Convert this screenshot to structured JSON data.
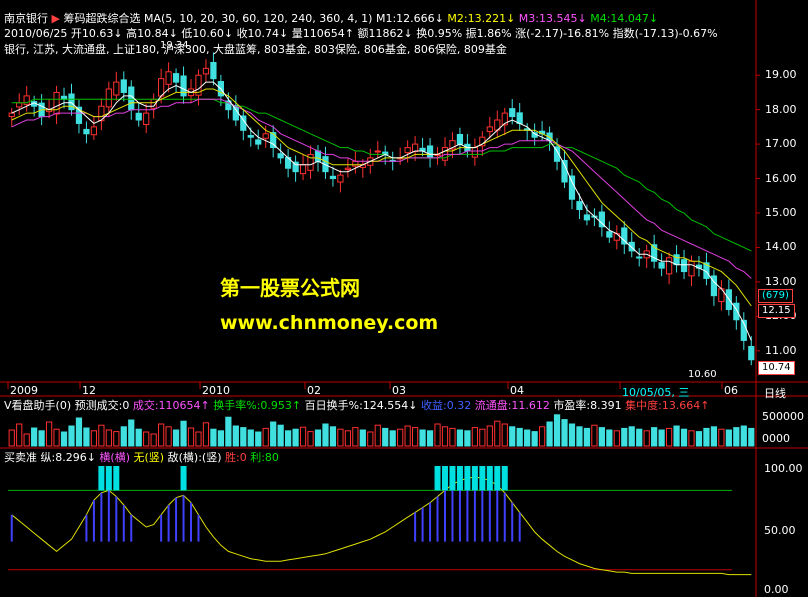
{
  "header": {
    "stock_name": "南京银行",
    "formula_name": "筹码超跌综合选",
    "ma_label": "MA(5, 10, 20, 30, 60, 120, 240, 360, 4, 1)",
    "m1": "M1:12.666↓",
    "m2": "M2:13.221↓",
    "m3": "M3:13.545↓",
    "m4": "M4:14.047↓"
  },
  "quote": {
    "date": "2010/06/25",
    "open": "开10.63↓",
    "high": "高10.84↓",
    "low": "低10.60↓",
    "close": "收10.74↓",
    "volume": "量110654↑",
    "amount": "额11862↓",
    "turnover": "换0.95%",
    "amplitude": "振1.86%",
    "change": "涨(-2.17)-16.81%",
    "index": "指数(-17.13)-0.67%"
  },
  "sectors": "银行, 江苏, 大流通盘, 上证180, 沪深300, 大盘蓝筹, 803基金, 803保险, 806基金, 806保险, 809基金",
  "price_axis": [
    "19.00",
    "18.00",
    "17.00",
    "16.00",
    "15.00",
    "14.00",
    "13.00",
    "12.00",
    "11.00"
  ],
  "price_box": {
    "label1": "(679)",
    "label2": "12.15",
    "current": "10.74",
    "low_mark": "10.60",
    "high_mark": "19.34"
  },
  "time_axis": [
    "2009",
    "12",
    "2010",
    "02",
    "03",
    "04",
    "10/05/05, 三",
    "06"
  ],
  "time_unit": "日线",
  "watermark": {
    "line1": "第一股票公式网",
    "line2": "www.chnmoney.com"
  },
  "volume_panel": {
    "title": "V看盘助手(0)",
    "forecast": "预测成交:0",
    "volume": "成交:110654↑",
    "turn": "换手率%:0.953↑",
    "turn100": "百日换手%:124.554↓",
    "profit": "收益:0.32",
    "float": "流通盘:11.612",
    "pe": "市盈率:8.391",
    "conc": "集中度:13.664↑",
    "axis": [
      "500000",
      "0000"
    ]
  },
  "indicator_panel": {
    "title": "买卖准",
    "v": "纵:8.296↓",
    "h1": "横(横)",
    "h2": "无(竖)",
    "enemy": "敌(横):(竖)",
    "win": "胜:0",
    "profit": "利:80",
    "axis": [
      "100.00",
      "50.00",
      "0.00"
    ]
  },
  "chart_data": {
    "type": "candlestick",
    "ylim": [
      10.5,
      19.5
    ],
    "closes": [
      17.9,
      18.2,
      18.4,
      18.1,
      17.8,
      18.0,
      18.5,
      18.3,
      18.0,
      17.6,
      17.3,
      17.5,
      18.1,
      18.6,
      18.8,
      18.5,
      18.0,
      17.7,
      17.9,
      18.3,
      18.9,
      19.1,
      18.8,
      18.4,
      18.6,
      19.0,
      19.2,
      18.9,
      18.4,
      18.0,
      17.7,
      17.4,
      17.2,
      17.0,
      17.3,
      16.9,
      16.6,
      16.3,
      16.2,
      16.4,
      16.7,
      16.5,
      16.2,
      16.0,
      16.1,
      16.3,
      16.5,
      16.4,
      16.6,
      16.8,
      16.7,
      16.5,
      16.6,
      16.9,
      17.0,
      16.8,
      16.6,
      16.7,
      16.9,
      17.1,
      17.0,
      16.8,
      16.9,
      17.2,
      17.5,
      17.7,
      17.9,
      17.8,
      17.6,
      17.4,
      17.2,
      17.3,
      17.1,
      16.5,
      15.9,
      15.4,
      15.1,
      14.8,
      14.9,
      14.6,
      14.3,
      14.4,
      14.1,
      13.9,
      13.7,
      13.9,
      13.6,
      13.4,
      13.7,
      13.5,
      13.3,
      13.6,
      13.4,
      13.1,
      12.6,
      12.8,
      12.2,
      11.9,
      11.3,
      10.74
    ],
    "ma_white": [
      17.9,
      18.0,
      18.1,
      18.2,
      18.1,
      18.0,
      18.1,
      18.2,
      18.2,
      18.0,
      17.8,
      17.6,
      17.7,
      17.9,
      18.2,
      18.4,
      18.4,
      18.2,
      18.1,
      18.1,
      18.4,
      18.6,
      18.7,
      18.6,
      18.5,
      18.6,
      18.8,
      18.8,
      18.6,
      18.3,
      18.0,
      17.7,
      17.4,
      17.2,
      17.1,
      17.0,
      16.8,
      16.6,
      16.4,
      16.4,
      16.4,
      16.5,
      16.4,
      16.3,
      16.2,
      16.2,
      16.3,
      16.4,
      16.5,
      16.6,
      16.7,
      16.6,
      16.6,
      16.7,
      16.8,
      16.8,
      16.7,
      16.7,
      16.8,
      16.9,
      17.0,
      16.9,
      16.9,
      17.0,
      17.2,
      17.4,
      17.6,
      17.7,
      17.6,
      17.5,
      17.3,
      17.2,
      17.1,
      16.8,
      16.4,
      15.9,
      15.5,
      15.1,
      14.9,
      14.7,
      14.5,
      14.4,
      14.2,
      14.0,
      13.8,
      13.8,
      13.7,
      13.6,
      13.6,
      13.5,
      13.5,
      13.5,
      13.4,
      13.3,
      13.0,
      12.8,
      12.5,
      12.2,
      11.8,
      11.3
    ],
    "ma_yellow": [
      17.7,
      17.8,
      17.9,
      17.9,
      18.0,
      18.0,
      18.0,
      18.1,
      18.1,
      18.0,
      17.9,
      17.8,
      17.8,
      17.9,
      18.0,
      18.1,
      18.2,
      18.2,
      18.2,
      18.2,
      18.3,
      18.4,
      18.5,
      18.5,
      18.5,
      18.5,
      18.6,
      18.6,
      18.5,
      18.4,
      18.2,
      18.0,
      17.8,
      17.6,
      17.4,
      17.3,
      17.1,
      16.9,
      16.8,
      16.7,
      16.6,
      16.6,
      16.5,
      16.4,
      16.4,
      16.4,
      16.4,
      16.4,
      16.5,
      16.5,
      16.6,
      16.6,
      16.6,
      16.6,
      16.7,
      16.7,
      16.7,
      16.7,
      16.8,
      16.8,
      16.9,
      16.9,
      16.9,
      17.0,
      17.1,
      17.2,
      17.3,
      17.4,
      17.4,
      17.4,
      17.4,
      17.3,
      17.2,
      17.0,
      16.8,
      16.5,
      16.2,
      15.9,
      15.6,
      15.3,
      15.1,
      14.9,
      14.7,
      14.5,
      14.3,
      14.2,
      14.0,
      13.9,
      13.8,
      13.7,
      13.7,
      13.6,
      13.6,
      13.5,
      13.4,
      13.3,
      13.1,
      12.9,
      12.6,
      12.3
    ],
    "ma_magenta": [
      17.5,
      17.6,
      17.7,
      17.7,
      17.8,
      17.8,
      17.9,
      17.9,
      17.9,
      17.9,
      17.9,
      17.8,
      17.8,
      17.8,
      17.9,
      17.9,
      18.0,
      18.0,
      18.0,
      18.0,
      18.1,
      18.1,
      18.2,
      18.2,
      18.2,
      18.3,
      18.3,
      18.3,
      18.3,
      18.2,
      18.1,
      18.0,
      17.9,
      17.7,
      17.6,
      17.5,
      17.3,
      17.2,
      17.1,
      17.0,
      16.9,
      16.8,
      16.7,
      16.7,
      16.6,
      16.6,
      16.5,
      16.5,
      16.5,
      16.5,
      16.5,
      16.5,
      16.5,
      16.6,
      16.6,
      16.6,
      16.6,
      16.6,
      16.7,
      16.7,
      16.7,
      16.8,
      16.8,
      16.8,
      16.9,
      16.9,
      17.0,
      17.0,
      17.1,
      17.1,
      17.1,
      17.1,
      17.1,
      17.0,
      16.9,
      16.8,
      16.6,
      16.4,
      16.2,
      16.0,
      15.8,
      15.6,
      15.4,
      15.2,
      15.0,
      14.8,
      14.7,
      14.5,
      14.4,
      14.3,
      14.2,
      14.1,
      14.0,
      13.9,
      13.8,
      13.7,
      13.6,
      13.4,
      13.3,
      13.1
    ],
    "ma_green": [
      18.2,
      18.2,
      18.2,
      18.3,
      18.3,
      18.3,
      18.3,
      18.3,
      18.3,
      18.3,
      18.3,
      18.3,
      18.3,
      18.3,
      18.3,
      18.3,
      18.3,
      18.3,
      18.3,
      18.3,
      18.3,
      18.3,
      18.3,
      18.3,
      18.3,
      18.3,
      18.3,
      18.3,
      18.2,
      18.2,
      18.1,
      18.1,
      18.0,
      17.9,
      17.9,
      17.8,
      17.7,
      17.6,
      17.5,
      17.4,
      17.3,
      17.2,
      17.1,
      17.0,
      16.9,
      16.9,
      16.8,
      16.8,
      16.7,
      16.7,
      16.7,
      16.6,
      16.6,
      16.6,
      16.6,
      16.6,
      16.6,
      16.6,
      16.6,
      16.7,
      16.7,
      16.7,
      16.7,
      16.7,
      16.8,
      16.8,
      16.8,
      16.9,
      16.9,
      16.9,
      16.9,
      16.9,
      17.0,
      17.0,
      16.9,
      16.9,
      16.8,
      16.7,
      16.6,
      16.5,
      16.4,
      16.3,
      16.1,
      16.0,
      15.9,
      15.7,
      15.6,
      15.4,
      15.3,
      15.1,
      15.0,
      14.8,
      14.7,
      14.6,
      14.4,
      14.3,
      14.2,
      14.1,
      14.0,
      13.9
    ],
    "volume": [
      40,
      55,
      30,
      45,
      38,
      60,
      42,
      35,
      50,
      70,
      45,
      38,
      52,
      40,
      36,
      48,
      65,
      42,
      35,
      30,
      55,
      48,
      40,
      62,
      45,
      35,
      58,
      42,
      38,
      72,
      50,
      46,
      40,
      35,
      44,
      60,
      52,
      38,
      42,
      47,
      36,
      40,
      55,
      48,
      42,
      38,
      46,
      40,
      35,
      52,
      44,
      38,
      42,
      50,
      46,
      40,
      38,
      55,
      48,
      44,
      40,
      38,
      46,
      42,
      50,
      62,
      55,
      48,
      44,
      40,
      36,
      48,
      60,
      78,
      66,
      55,
      48,
      44,
      52,
      46,
      40,
      38,
      44,
      48,
      42,
      38,
      46,
      40,
      44,
      50,
      42,
      38,
      36,
      44,
      48,
      42,
      40,
      46,
      50,
      44
    ],
    "osc": [
      60,
      55,
      50,
      45,
      40,
      35,
      30,
      35,
      40,
      50,
      60,
      72,
      78,
      80,
      75,
      68,
      60,
      55,
      50,
      52,
      60,
      68,
      74,
      76,
      70,
      60,
      50,
      42,
      35,
      30,
      28,
      26,
      24,
      23,
      22,
      22,
      22,
      23,
      24,
      25,
      26,
      27,
      28,
      30,
      32,
      34,
      36,
      38,
      40,
      43,
      46,
      50,
      54,
      58,
      62,
      66,
      70,
      75,
      80,
      85,
      88,
      90,
      91,
      90,
      88,
      84,
      78,
      70,
      62,
      54,
      46,
      40,
      35,
      30,
      26,
      23,
      20,
      18,
      16,
      15,
      14,
      13,
      13,
      12,
      12,
      12,
      12,
      12,
      12,
      12,
      12,
      12,
      12,
      12,
      12,
      12,
      11,
      11,
      11,
      11
    ],
    "ma_count": 100
  }
}
